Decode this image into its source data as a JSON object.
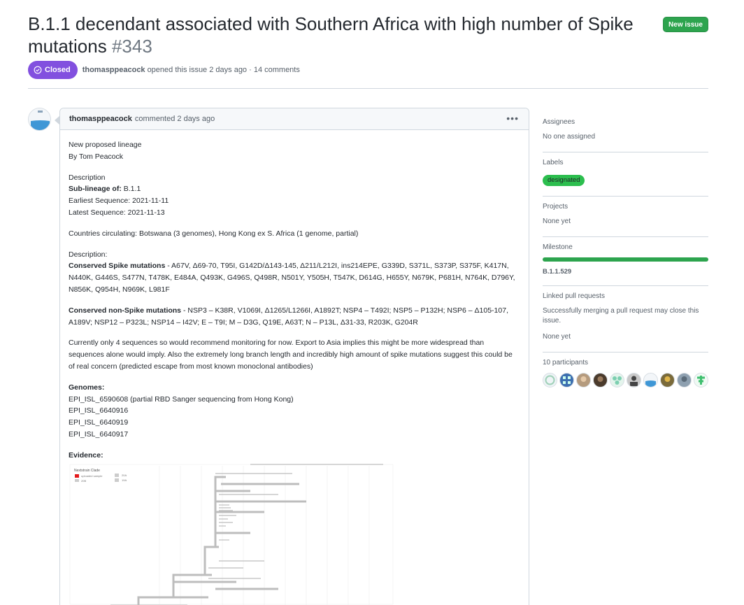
{
  "issue": {
    "title": "B.1.1 decendant associated with Southern Africa with high number of Spike mutations",
    "number": "#343",
    "state": "Closed",
    "author": "thomasppeacock",
    "opened_text": "opened this issue 2 days ago · 14 comments"
  },
  "header": {
    "new_issue_label": "New issue"
  },
  "comment": {
    "author": "thomasppeacock",
    "time_text": "commented 2 days ago",
    "menu_icon": "kebab-horizontal-icon",
    "lines": {
      "proposal": "New proposed lineage",
      "by": "By Tom Peacock",
      "description_heading": "Description",
      "sublineage_label": "Sub-lineage of:",
      "sublineage_value": " B.1.1",
      "earliest": "Earliest Sequence: 2021-11-11",
      "latest": "Latest Sequence: 2021-11-13",
      "countries": "Countries circulating: Botswana (3 genomes), Hong Kong ex S. Africa (1 genome, partial)",
      "description2": "Description:",
      "spike_label": "Conserved Spike mutations",
      "spike_value": " - A67V, Δ69-70, T95I, G142D/Δ143-145, Δ211/L212I, ins214EPE, G339D, S371L, S373P, S375F, K417N, N440K, G446S, S477N, T478K, E484A, Q493K, G496S, Q498R, N501Y, Y505H, T547K, D614G, H655Y, N679K, P681H, N764K, D796Y, N856K, Q954H, N969K, L981F",
      "nonspike_label": "Conserved non-Spike mutations",
      "nonspike_value": " - NSP3 – K38R, V1069I, Δ1265/L1266I, A1892T; NSP4 – T492I; NSP5 – P132H; NSP6 – Δ105-107, A189V; NSP12 – P323L; NSP14 – I42V; E – T9I; M – D3G, Q19E, A63T; N – P13L, Δ31-33, R203K, G204R",
      "currently": "Currently only 4 sequences so would recommend monitoring for now. Export to Asia implies this might be more widespread than sequences alone would imply. Also the extremely long branch length and incredibly high amount of spike mutations suggest this could be of real concern (predicted escape from most known monoclonal antibodies)",
      "genomes_heading": "Genomes:",
      "genome_1": "EPI_ISL_6590608 (partial RBD Sanger sequencing from Hong Kong)",
      "genome_2": "EPI_ISL_6640916",
      "genome_3": "EPI_ISL_6640919",
      "genome_4": "EPI_ISL_6640917",
      "evidence_heading": "Evidence:"
    },
    "evidence_figure": {
      "legend_title": "Nextstrain Clade",
      "legend_items": [
        "uploaded sample",
        "20B",
        "20A",
        "19A"
      ],
      "colors": {
        "uploaded": "#e31a1c",
        "tree": "#bdbdbd"
      }
    }
  },
  "sidebar": {
    "assignees_title": "Assignees",
    "assignees_value": "No one assigned",
    "labels_title": "Labels",
    "label_designated": "designated",
    "label_color": "#2cbe4e",
    "projects_title": "Projects",
    "projects_value": "None yet",
    "milestone_title": "Milestone",
    "milestone_progress": 1.0,
    "milestone_name": "B.1.1.529",
    "linked_title": "Linked pull requests",
    "linked_desc": "Successfully merging a pull request may close this issue.",
    "linked_value": "None yet",
    "participants_title": "10 participants"
  },
  "colors": {
    "closed": "#8250df",
    "new_issue": "#2da44e",
    "border": "#d0d7de"
  }
}
